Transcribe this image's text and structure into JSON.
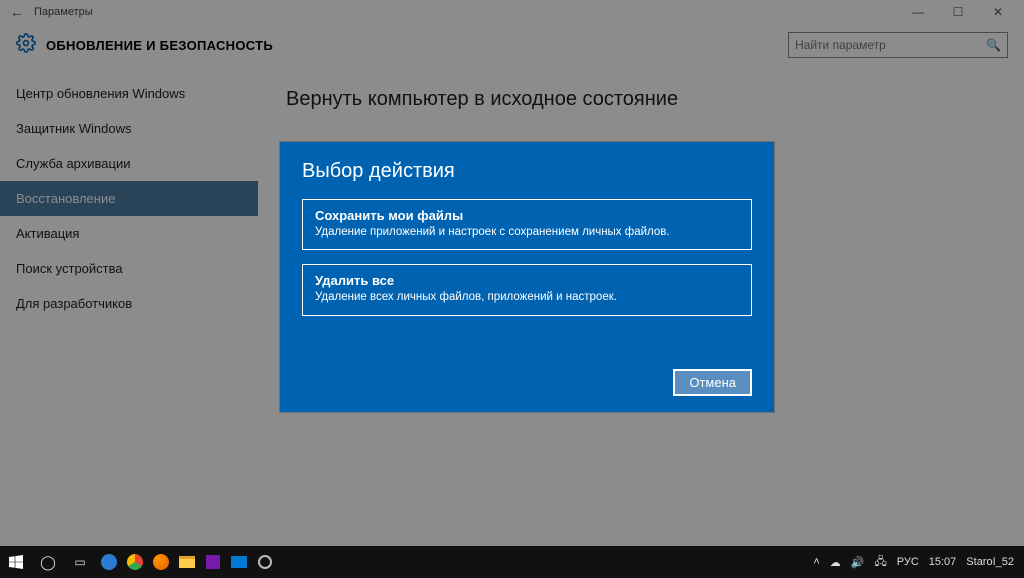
{
  "window": {
    "title": "Параметры",
    "minimize": "—",
    "maximize": "☐",
    "close": "✕"
  },
  "header": {
    "category": "ОБНОВЛЕНИЕ И БЕЗОПАСНОСТЬ",
    "search_placeholder": "Найти параметр"
  },
  "sidebar": {
    "items": [
      {
        "label": "Центр обновления Windows"
      },
      {
        "label": "Защитник Windows"
      },
      {
        "label": "Служба архивации"
      },
      {
        "label": "Восстановление"
      },
      {
        "label": "Активация"
      },
      {
        "label": "Поиск устройства"
      },
      {
        "label": "Для разработчиков"
      }
    ],
    "active_index": 3
  },
  "main": {
    "heading": "Вернуть компьютер в исходное состояние"
  },
  "modal": {
    "title": "Выбор действия",
    "options": [
      {
        "title": "Сохранить мои файлы",
        "desc": "Удаление приложений и настроек с сохранением личных файлов."
      },
      {
        "title": "Удалить все",
        "desc": "Удаление всех личных файлов, приложений и настроек."
      }
    ],
    "cancel": "Отмена"
  },
  "taskbar": {
    "lang": "РУС",
    "time": "15:07",
    "user": "StaroI_52"
  }
}
